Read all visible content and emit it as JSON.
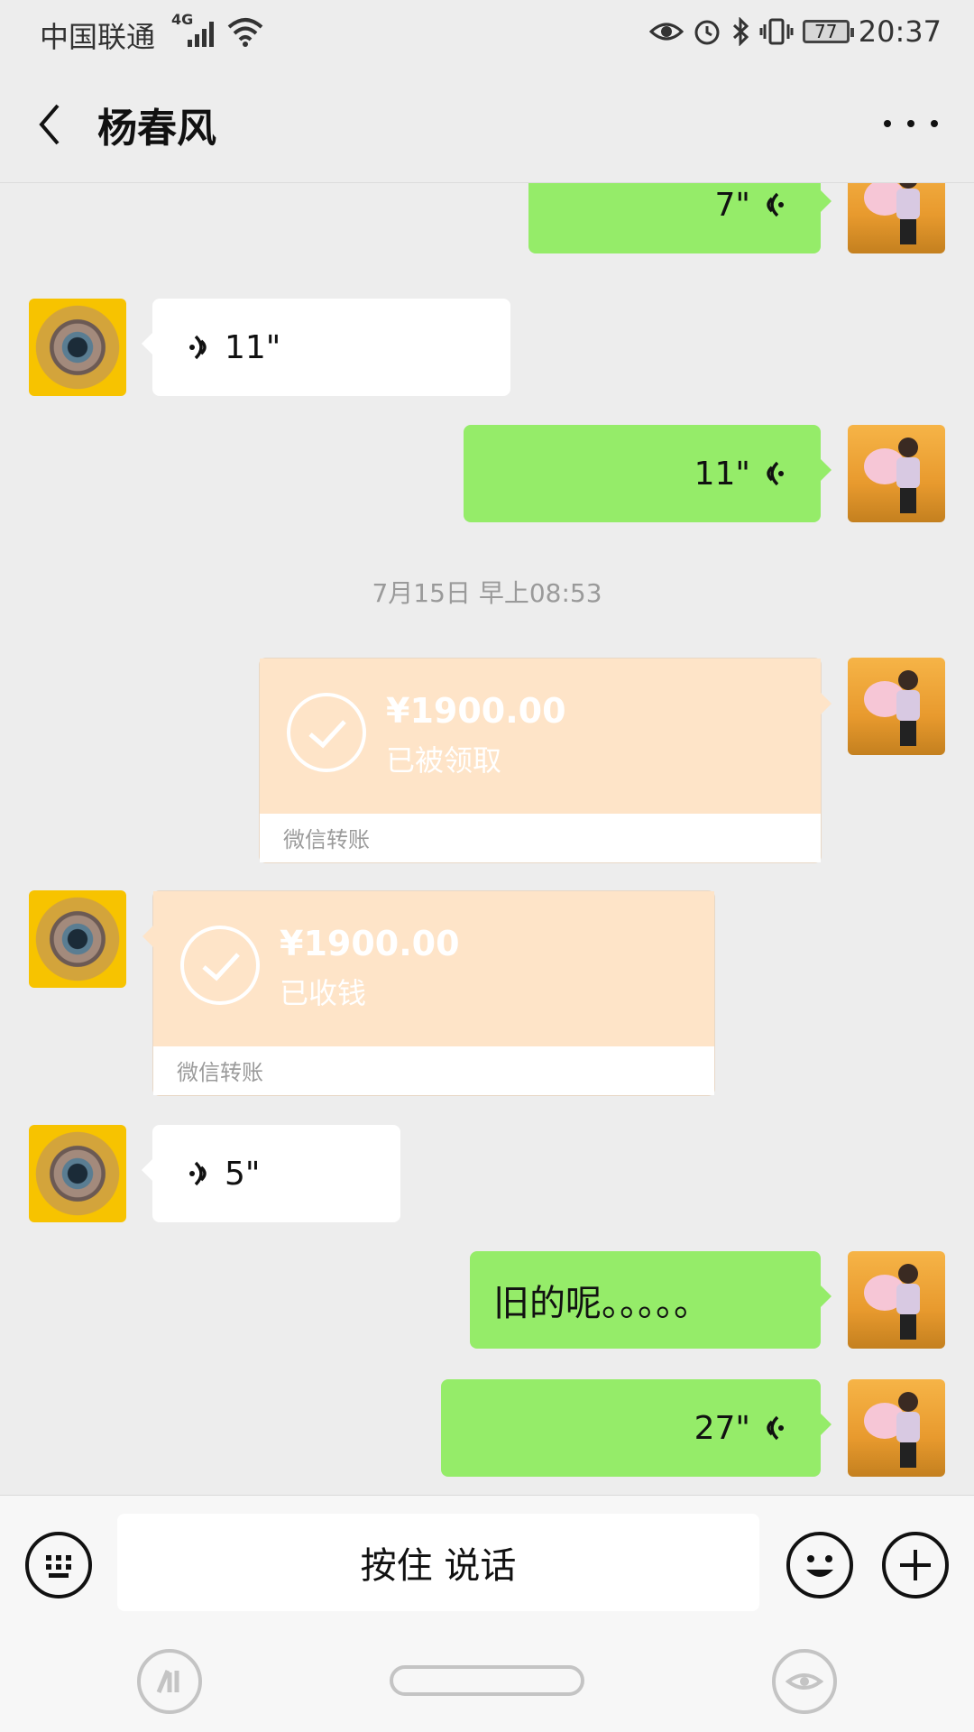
{
  "status_bar": {
    "carrier": "中国联通",
    "network": "4G",
    "battery": "77",
    "time": "20:37"
  },
  "header": {
    "title": "杨春风"
  },
  "messages": [
    {
      "type": "voice",
      "side": "right",
      "duration": "7\""
    },
    {
      "type": "voice",
      "side": "left",
      "duration": "11\""
    },
    {
      "type": "voice",
      "side": "right",
      "duration": "11\""
    },
    {
      "type": "timestamp",
      "text": "7月15日 早上08:53"
    },
    {
      "type": "transfer",
      "side": "right",
      "amount": "¥1900.00",
      "status": "已被领取",
      "label": "微信转账"
    },
    {
      "type": "transfer",
      "side": "left",
      "amount": "¥1900.00",
      "status": "已收钱",
      "label": "微信转账"
    },
    {
      "type": "voice",
      "side": "left",
      "duration": "5\""
    },
    {
      "type": "text",
      "side": "right",
      "text": "旧的呢。。。。。"
    },
    {
      "type": "voice",
      "side": "right",
      "duration": "27\""
    }
  ],
  "input_bar": {
    "hold_to_talk": "按住 说话"
  },
  "colors": {
    "outgoing_bubble": "#95ec69",
    "incoming_bubble": "#ffffff",
    "transfer": "#fee4c8",
    "background": "#ededed"
  }
}
